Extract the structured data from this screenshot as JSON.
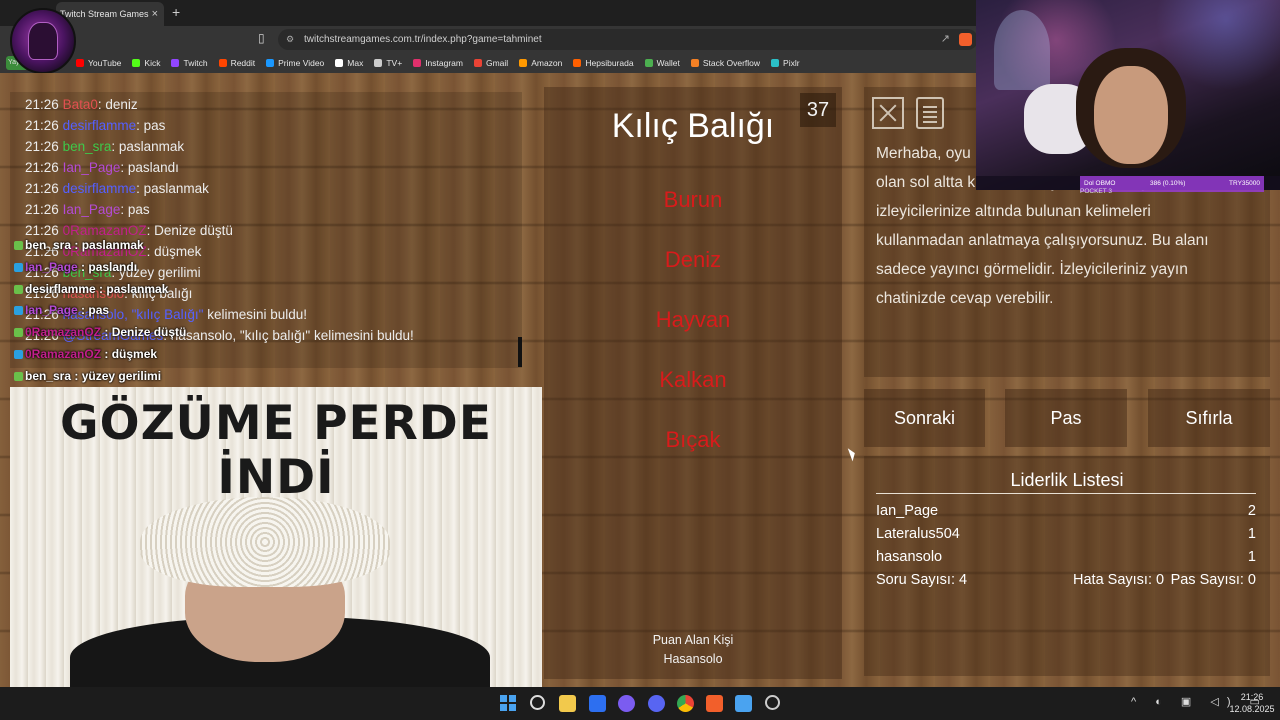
{
  "browser": {
    "tab_title": "Twitch Stream Games",
    "tab_close": "×",
    "new_tab": "+",
    "url": "twitchstreamgames.com.tr/index.php?game=tahminet",
    "bookmark_first": "Yay",
    "bookmarks": [
      "YouTube",
      "Kick",
      "Twitch",
      "Reddit",
      "Prime Video",
      "Max",
      "TV+",
      "Instagram",
      "Gmail",
      "Amazon",
      "Hepsiburada",
      "Wallet",
      "Stack Overflow",
      "Pixlr"
    ],
    "bookmark_colors": [
      "#ff0000",
      "#53fc18",
      "#9146ff",
      "#ff4500",
      "#1a98ff",
      "#ffffff",
      "#cccccc",
      "#e1306c",
      "#ea4335",
      "#ff9900",
      "#ff6000",
      "#4caf50",
      "#f48024",
      "#2bc0c8"
    ]
  },
  "chat": {
    "lines": [
      {
        "time": "21:26",
        "user": "Bata0",
        "color": "#e05050",
        "msg": ": deniz"
      },
      {
        "time": "21:26",
        "user": "desirflamme",
        "color": "#5560ff",
        "msg": ": pas"
      },
      {
        "time": "21:26",
        "user": "ben_sra",
        "color": "#3ec94a",
        "msg": ": paslanmak"
      },
      {
        "time": "21:26",
        "user": "Ian_Page",
        "color": "#b44bd4",
        "msg": ": paslandı"
      },
      {
        "time": "21:26",
        "user": "desirflamme",
        "color": "#5560ff",
        "msg": ": paslanmak"
      },
      {
        "time": "21:26",
        "user": "Ian_Page",
        "color": "#b44bd4",
        "msg": ": pas"
      },
      {
        "time": "21:26",
        "user": "0RamazanOZ",
        "color": "#c21f8c",
        "msg": ": Denize düştü"
      },
      {
        "time": "21:26",
        "user": "0RamazanOZ",
        "color": "#c21f8c",
        "msg": ": düşmek"
      },
      {
        "time": "21:26",
        "user": "ben_sra",
        "color": "#3ec94a",
        "msg": ": yüzey gerilimi"
      },
      {
        "time": "21:26",
        "user": "hasansolo",
        "color": "#e05050",
        "msg": ": kılıç balığı"
      },
      {
        "time": "21:26",
        "user": "hasansolo, \"kılıç Balığı\"",
        "color": "#5560ff",
        "msg": " kelimesini buldu!"
      },
      {
        "time": "21:26",
        "user": "@StreamGames",
        "color": "#5560ff",
        "msg": ": hasansolo, \"kılıç balığı\" kelimesini buldu!"
      }
    ]
  },
  "overlay_chat": [
    {
      "user": "ben_sra",
      "color": "#ffffff",
      "msg": " : paslanmak"
    },
    {
      "user": "Ian_Page",
      "color": "#b44bd4",
      "msg": " : paslandı"
    },
    {
      "user": "desirflamme",
      "color": "#ffffff",
      "msg": " : paslanmak"
    },
    {
      "user": "Ian_Page",
      "color": "#b44bd4",
      "msg": " : pas"
    },
    {
      "user": "0RamazanOZ",
      "color": "#c21f8c",
      "msg": " : Denize düştü"
    },
    {
      "user": "0RamazanOZ",
      "color": "#c21f8c",
      "msg": " : düşmek"
    },
    {
      "user": "ben_sra",
      "color": "#ffffff",
      "msg": " : yüzey gerilimi"
    }
  ],
  "meme": {
    "line1": "GÖZÜME PERDE",
    "line2": "İNDİ"
  },
  "game": {
    "timer": "37",
    "word": "Kılıç Balığı",
    "forbidden": [
      "Burun",
      "Deniz",
      "Hayvan",
      "Kalkan",
      "Bıçak"
    ],
    "scorer_label": "Puan Alan Kişi",
    "scorer_name": "Hasansolo"
  },
  "info": {
    "text": "Merhaba, oyu... olan sol altta ki bölüm de yazan kelimeyi izleyicilerinize altında bulunan kelimeleri kullanmadan anlatmaya çalışıyorsunuz. Bu alanı sadece yayıncı görmelidir. İzleyicileriniz yayın chatinizde cevap verebilir.",
    "line1": "Merhaba, oyu",
    "line2": "olan sol altta ki bölüm de yazan kelimeyi",
    "line3": "izleyicilerinize altında bulunan kelimeleri",
    "line4": "kullanmadan anlatmaya çalışıyorsunuz. Bu alanı",
    "line5": "sadece yayıncı görmelidir. İzleyicileriniz yayın",
    "line6": "chatinizde cevap verebilir."
  },
  "actions": {
    "next": "Sonraki",
    "pass": "Pas",
    "reset": "Sıfırla"
  },
  "leaderboard": {
    "title": "Liderlik Listesi",
    "rows": [
      {
        "name": "Ian_Page",
        "score": "2"
      },
      {
        "name": "Lateralus504",
        "score": "1"
      },
      {
        "name": "hasansolo",
        "score": "1"
      }
    ],
    "questions": "Soru Sayısı: 4",
    "errors": "Hata Sayısı: 0",
    "passes": "Pas Sayısı: 0"
  },
  "webcam_overlay": {
    "left": "Dol OBMO",
    "sub": "POCKET 3",
    "mid": "386 (0.10%)",
    "right": "TRY35000"
  },
  "taskbar": {
    "time": "21:26",
    "date": "12.08.2025"
  }
}
